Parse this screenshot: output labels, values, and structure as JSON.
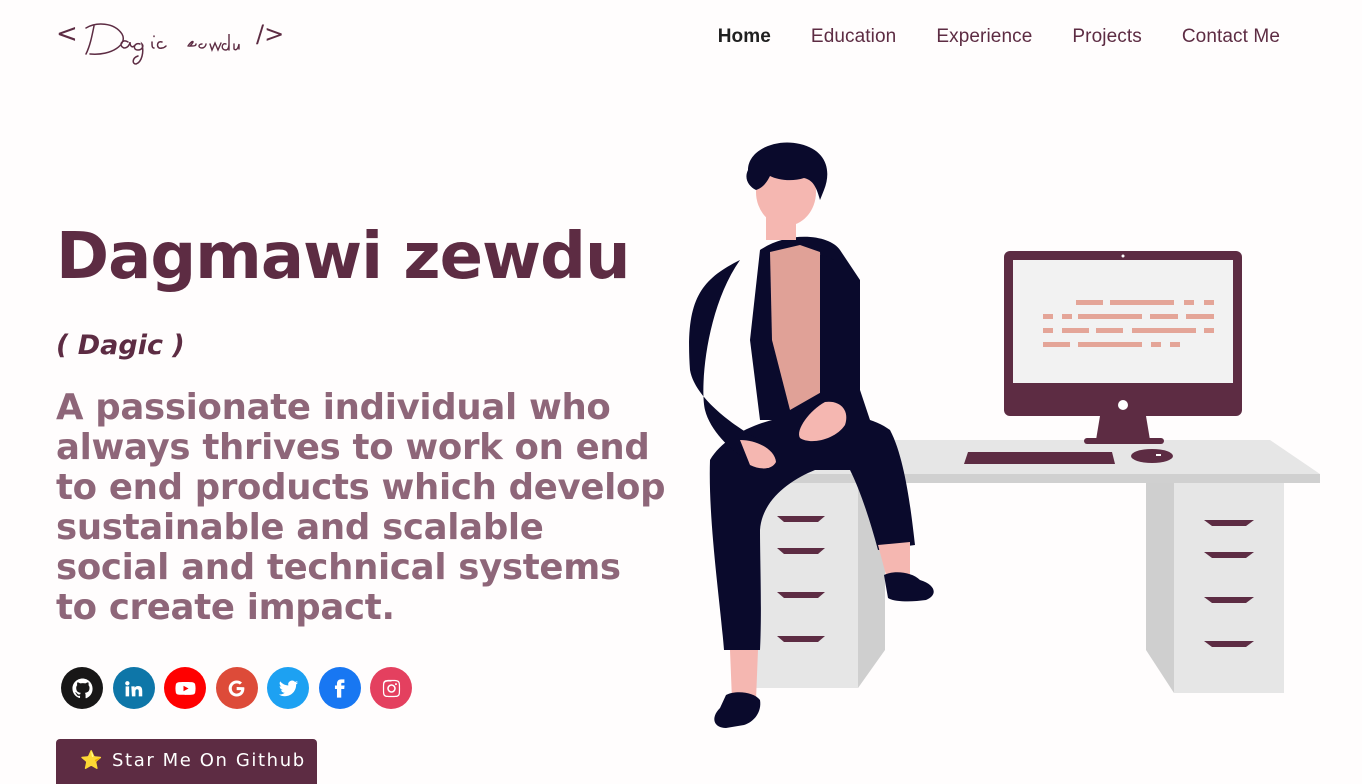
{
  "header": {
    "logo_text": "< Dagic zewdu />",
    "logo_left": "<",
    "logo_right": "/>",
    "nav": [
      {
        "label": "Home",
        "active": true
      },
      {
        "label": "Education",
        "active": false
      },
      {
        "label": "Experience",
        "active": false
      },
      {
        "label": "Projects",
        "active": false
      },
      {
        "label": "Contact Me",
        "active": false
      }
    ]
  },
  "hero": {
    "name": "Dagmawi zewdu",
    "nickname": "( Dagic )",
    "bio": "A passionate individual who always thrives to work on end to end products which develop sustainable and scalable social and technical systems to create impact."
  },
  "socials": [
    {
      "name": "github",
      "icon": "github-icon",
      "color": "#181717"
    },
    {
      "name": "linkedin",
      "icon": "linkedin-icon",
      "color": "#0e76a8"
    },
    {
      "name": "youtube",
      "icon": "youtube-icon",
      "color": "#ff0000"
    },
    {
      "name": "google",
      "icon": "google-icon",
      "color": "#dd4b39"
    },
    {
      "name": "twitter",
      "icon": "twitter-icon",
      "color": "#1da1f2"
    },
    {
      "name": "facebook",
      "icon": "facebook-icon",
      "color": "#1877f2"
    },
    {
      "name": "instagram",
      "icon": "instagram-icon",
      "color": "#e4405f"
    }
  ],
  "cta": {
    "star_icon": "⭐",
    "label": "Star Me On Github"
  },
  "colors": {
    "primary": "#5d2c43",
    "bio_text": "#8e6679",
    "background": "#fffdfd",
    "button_bg": "#5d2c43"
  }
}
